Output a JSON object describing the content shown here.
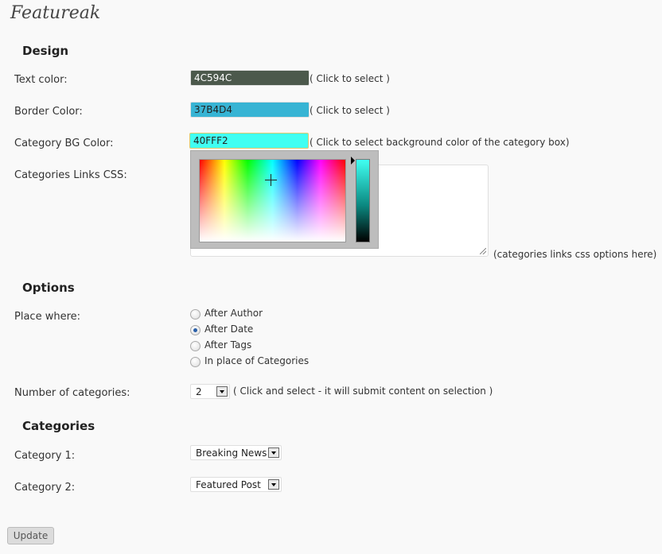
{
  "page_title": "Featureak",
  "design": {
    "heading": "Design",
    "text_color": {
      "label": "Text color:",
      "value": "4C594C",
      "bg": "#4c594c",
      "fg": "#ffffff",
      "hint": "( Click to select )"
    },
    "border_color": {
      "label": "Border Color:",
      "value": "37B4D4",
      "bg": "#37b4d4",
      "fg": "#222222",
      "hint": "( Click to select )"
    },
    "category_bg_color": {
      "label": "Category BG Color:",
      "value": "40FFF2",
      "bg": "#40fff2",
      "fg": "#222222",
      "hint": "( Click to select background color of the category box)"
    },
    "links_css": {
      "label": "Categories Links CSS:",
      "value": "",
      "hint": "(categories links css options here)"
    }
  },
  "options": {
    "heading": "Options",
    "place_where_label": "Place where:",
    "place_where": [
      {
        "label": "After Author",
        "checked": false
      },
      {
        "label": "After Date",
        "checked": true
      },
      {
        "label": "After Tags",
        "checked": false
      },
      {
        "label": "In place of Categories",
        "checked": false
      }
    ],
    "num_categories_label": "Number of categories:",
    "num_categories_value": "2",
    "num_categories_hint": "( Click and select - it will submit content on selection )"
  },
  "categories": {
    "heading": "Categories",
    "items": [
      {
        "label": "Category 1:",
        "value": "Breaking News"
      },
      {
        "label": "Category 2:",
        "value": "Featured Post"
      }
    ]
  },
  "update_label": "Update",
  "colors": {
    "accent_radio": "#2a5fa8",
    "focus_border": "#e0c86a",
    "picker_frame": "#bdbdbd"
  }
}
